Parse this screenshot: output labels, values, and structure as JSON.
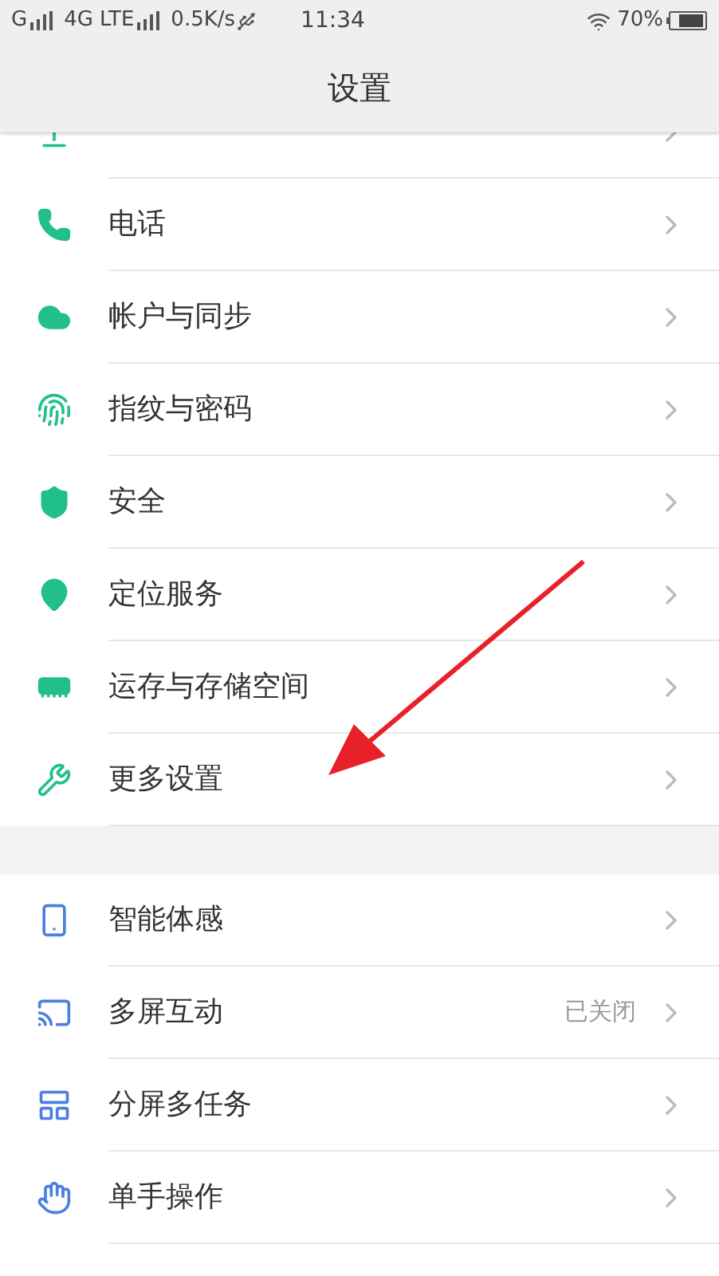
{
  "status_bar": {
    "carrier_1": "G",
    "carrier_2": "4G LTE",
    "speed": "0.5K/s",
    "time": "11:34",
    "battery": "70%"
  },
  "header": {
    "title": "设置"
  },
  "sections": [
    {
      "color": "#21c08b",
      "items": [
        {
          "kind": "partial"
        },
        {
          "label": "电话"
        },
        {
          "label": "帐户与同步"
        },
        {
          "label": "指纹与密码"
        },
        {
          "label": "安全"
        },
        {
          "label": "定位服务"
        },
        {
          "label": "运存与存储空间"
        },
        {
          "label": "更多设置"
        }
      ]
    },
    {
      "color": "#4b7fe0",
      "items": [
        {
          "label": "智能体感"
        },
        {
          "label": "多屏互动",
          "value": "已关闭"
        },
        {
          "label": "分屏多任务"
        },
        {
          "label": "单手操作"
        }
      ]
    }
  ]
}
